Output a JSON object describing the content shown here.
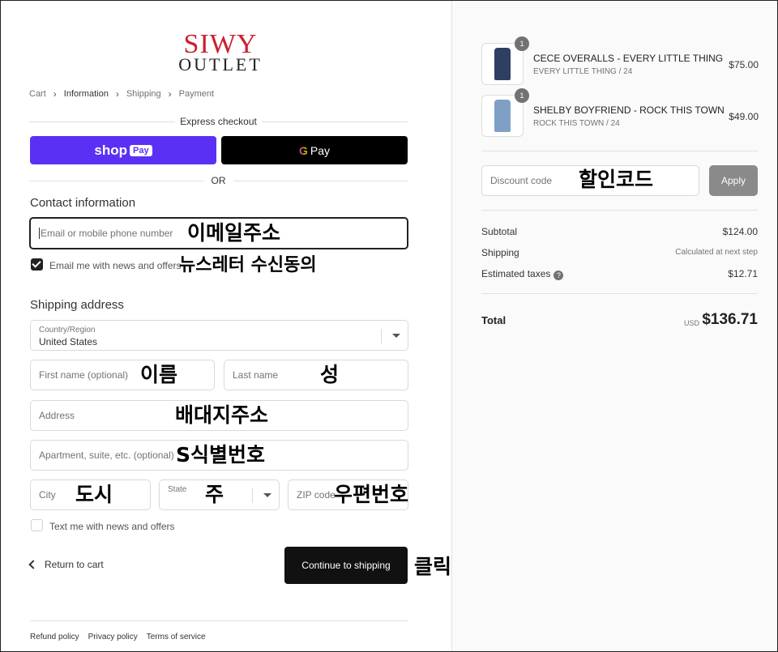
{
  "logo": {
    "line1": "SIWY",
    "line2": "OUTLET"
  },
  "breadcrumb": [
    "Cart",
    "Information",
    "Shipping",
    "Payment"
  ],
  "express": {
    "label": "Express checkout",
    "shop_pay": "shop",
    "shop_pay_tag": "Pay",
    "gpay_g": "G",
    "gpay_text": "Pay",
    "or": "OR"
  },
  "contact": {
    "title": "Contact information",
    "email_placeholder": "Email or mobile phone number",
    "email_annot": "이메일주소",
    "news_label": "Email me with news and offers",
    "news_checked": true,
    "news_annot": "뉴스레터 수신동의"
  },
  "shipping": {
    "title": "Shipping address",
    "country_label": "Country/Region",
    "country_value": "United States",
    "first_name": "First name (optional)",
    "first_annot": "이름",
    "last_name": "Last name",
    "last_annot": "성",
    "address": "Address",
    "address_annot": "배대지주소",
    "apt": "Apartment, suite, etc. (optional)",
    "apt_annot": "S식별번호",
    "city": "City",
    "city_annot": "도시",
    "state": "State",
    "state_annot": "주",
    "zip": "ZIP code",
    "zip_annot": "우편번호",
    "text_label": "Text me with news and offers",
    "text_checked": false
  },
  "actions": {
    "return": "Return to cart",
    "continue": "Continue to shipping",
    "continue_annot": "클릭"
  },
  "footer": [
    "Refund policy",
    "Privacy policy",
    "Terms of service"
  ],
  "order": {
    "items": [
      {
        "qty": "1",
        "name": "CECE OVERALLS - EVERY LITTLE THING",
        "variant": "EVERY LITTLE THING / 24",
        "price": "$75.00",
        "color": "#2f3e63"
      },
      {
        "qty": "1",
        "name": "SHELBY BOYFRIEND - ROCK THIS TOWN",
        "variant": "ROCK THIS TOWN / 24",
        "price": "$49.00",
        "color": "#7fa0c4"
      }
    ],
    "discount_placeholder": "Discount code",
    "discount_annot": "할인코드",
    "apply": "Apply",
    "subtotal_label": "Subtotal",
    "subtotal": "$124.00",
    "shipping_label": "Shipping",
    "shipping_value": "Calculated at next step",
    "taxes_label": "Estimated taxes",
    "taxes": "$12.71",
    "total_label": "Total",
    "currency": "USD",
    "total": "$136.71"
  }
}
